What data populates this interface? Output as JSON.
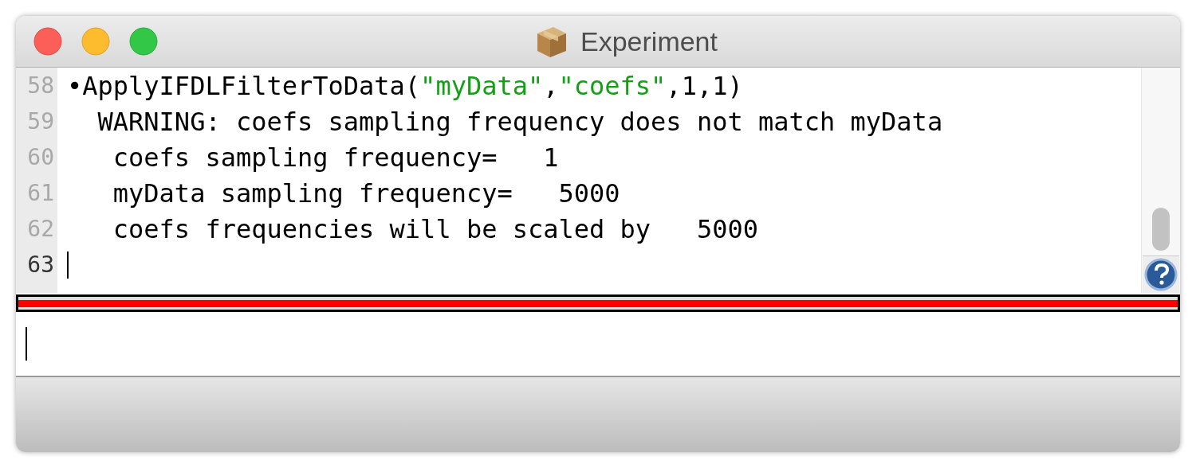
{
  "window": {
    "title": "Experiment"
  },
  "history": [
    {
      "number": "58",
      "current": false,
      "segments": [
        {
          "kind": "code",
          "text": "•ApplyIFDLFilterToData("
        },
        {
          "kind": "string",
          "text": "\"myData\""
        },
        {
          "kind": "code",
          "text": ","
        },
        {
          "kind": "string",
          "text": "\"coefs\""
        },
        {
          "kind": "code",
          "text": ",1,1)"
        }
      ]
    },
    {
      "number": "59",
      "current": false,
      "segments": [
        {
          "kind": "code",
          "text": "  WARNING: coefs sampling frequency does not match myData"
        }
      ]
    },
    {
      "number": "60",
      "current": false,
      "segments": [
        {
          "kind": "code",
          "text": "   coefs sampling frequency=   1"
        }
      ]
    },
    {
      "number": "61",
      "current": false,
      "segments": [
        {
          "kind": "code",
          "text": "   myData sampling frequency=   5000"
        }
      ]
    },
    {
      "number": "62",
      "current": false,
      "segments": [
        {
          "kind": "code",
          "text": "   coefs frequencies will be scaled by   5000"
        }
      ]
    },
    {
      "number": "63",
      "current": true
    }
  ]
}
